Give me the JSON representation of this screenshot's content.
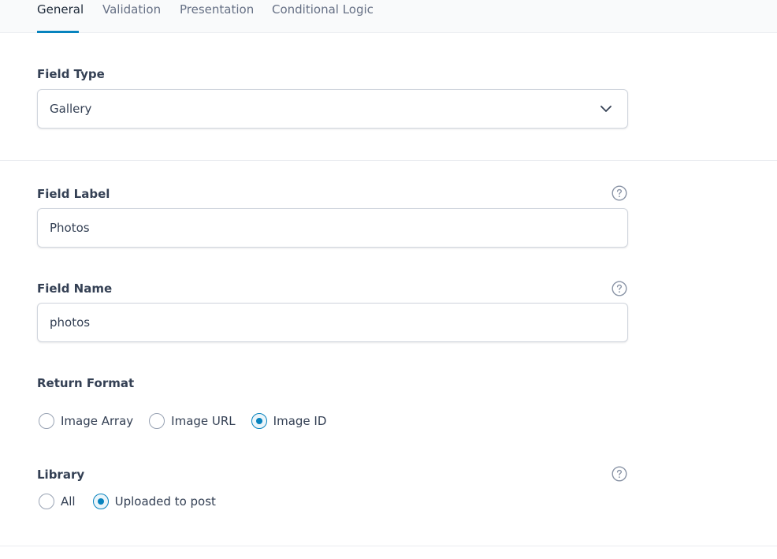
{
  "tabs": [
    {
      "label": "General",
      "active": true
    },
    {
      "label": "Validation",
      "active": false
    },
    {
      "label": "Presentation",
      "active": false
    },
    {
      "label": "Conditional Logic",
      "active": false
    }
  ],
  "field_type": {
    "label": "Field Type",
    "selected": "Gallery",
    "icon": "chevron-down-icon"
  },
  "field_label": {
    "label": "Field Label",
    "value": "Photos",
    "help_icon": "question-circle-icon"
  },
  "field_name": {
    "label": "Field Name",
    "value": "photos",
    "help_icon": "question-circle-icon"
  },
  "return_format": {
    "label": "Return Format",
    "options": [
      {
        "label": "Image Array",
        "checked": false
      },
      {
        "label": "Image URL",
        "checked": false
      },
      {
        "label": "Image ID",
        "checked": true
      }
    ]
  },
  "library": {
    "label": "Library",
    "help_icon": "question-circle-icon",
    "options": [
      {
        "label": "All",
        "checked": false
      },
      {
        "label": "Uploaded to post",
        "checked": true
      }
    ]
  },
  "colors": {
    "accent": "#0783be",
    "border": "#d0d5dd",
    "text": "#344054",
    "muted": "#667085"
  }
}
